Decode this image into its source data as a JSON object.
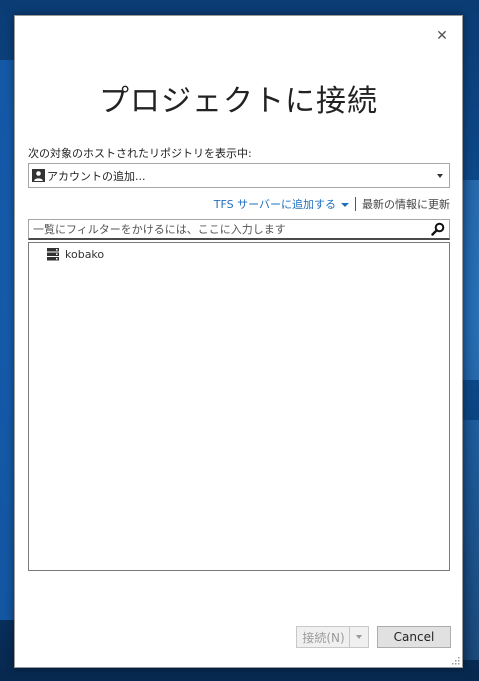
{
  "dialog": {
    "title": "プロジェクトに接続",
    "close_label": "✕",
    "hosted_label": "次の対象のホストされたリポジトリを表示中:",
    "account_select": {
      "selected": "アカウントの追加..."
    },
    "links": {
      "add_tfs": "TFS サーバーに追加する",
      "refresh": "最新の情報に更新"
    },
    "filter": {
      "placeholder": "一覧にフィルターをかけるには、ここに入力します",
      "value": ""
    },
    "repositories": [
      {
        "name": "kobako",
        "icon": "server-icon"
      }
    ],
    "buttons": {
      "connect": "接続(N)",
      "cancel": "Cancel"
    }
  },
  "colors": {
    "link": "#1e6fbd",
    "desktop": "#0d4f94"
  }
}
